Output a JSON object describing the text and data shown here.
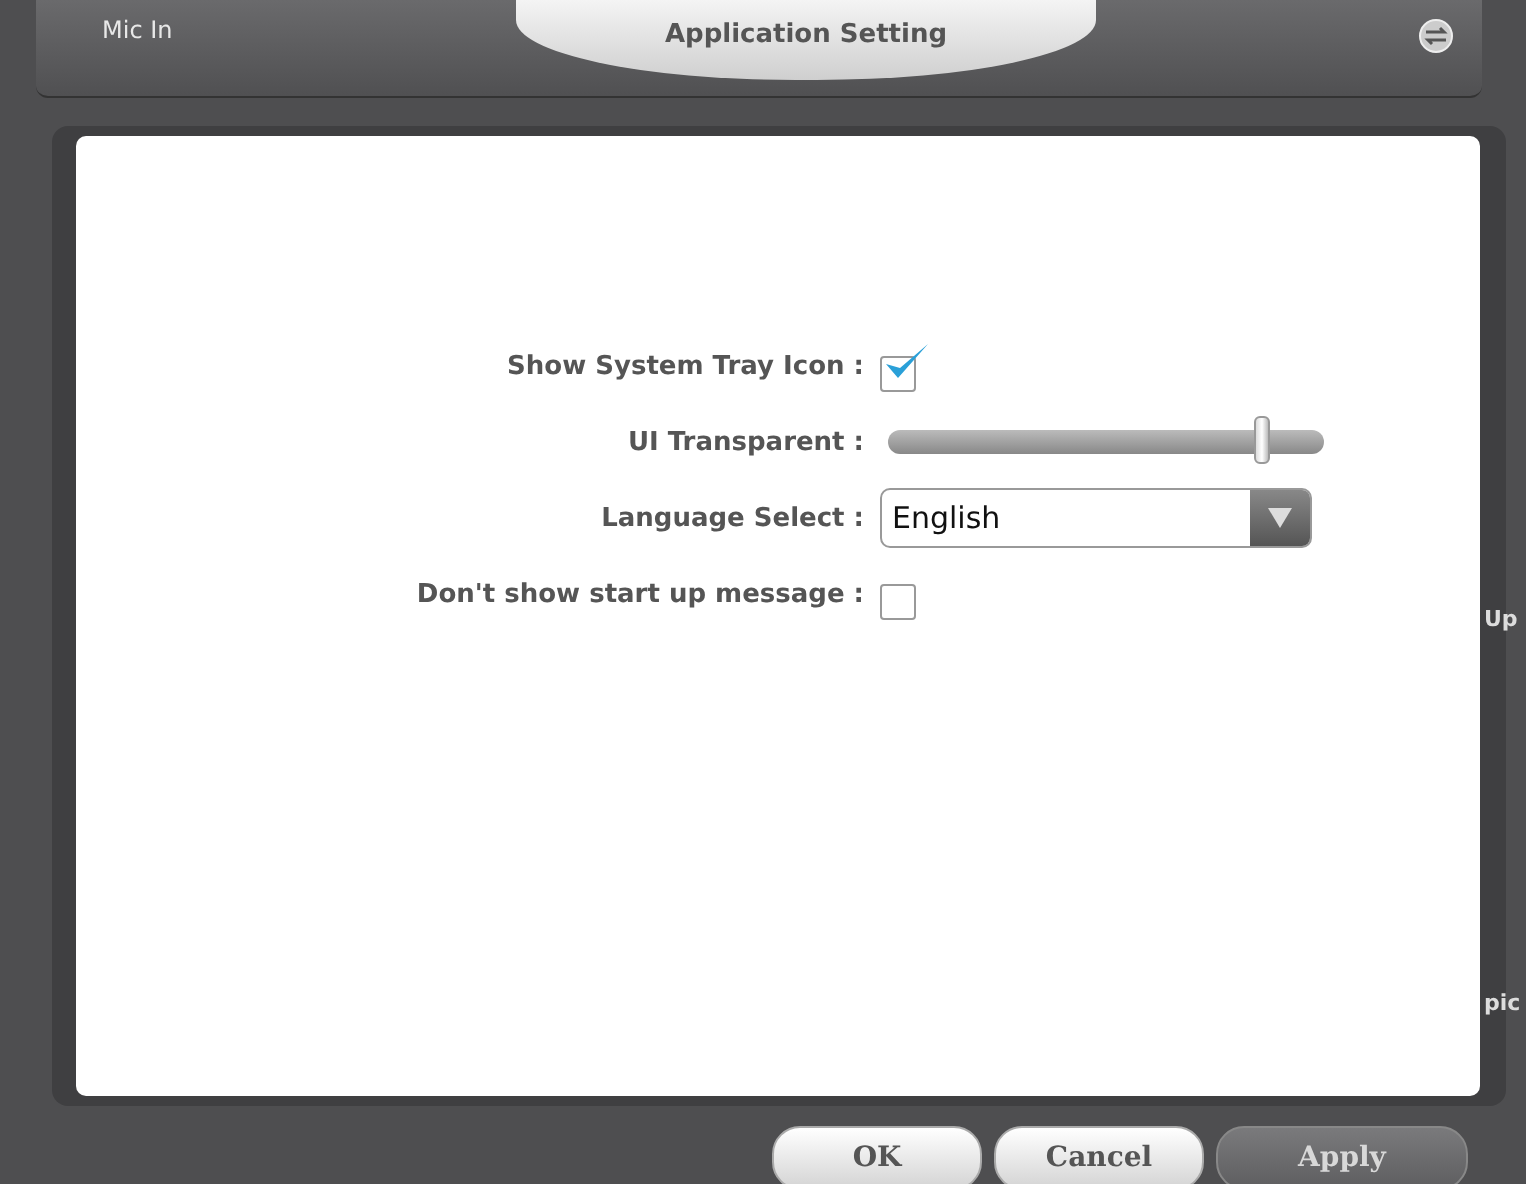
{
  "header": {
    "input_label": "Mic In",
    "title": "Application Setting"
  },
  "settings": [
    {
      "kind": "checkbox",
      "label": "Show System Tray Icon :",
      "checked": true
    },
    {
      "kind": "slider",
      "label": "UI Transparent :",
      "level": 0.86
    },
    {
      "kind": "dropdown",
      "label": "Language Select :",
      "value": "English"
    },
    {
      "kind": "checkbox",
      "label": "Don't show start up message :",
      "checked": false
    }
  ],
  "background_fragments": [
    "Up",
    "pic"
  ],
  "buttons": [
    {
      "label": "OK",
      "disabled": false
    },
    {
      "label": "Cancel",
      "disabled": false
    },
    {
      "label": "Apply",
      "disabled": true
    }
  ]
}
